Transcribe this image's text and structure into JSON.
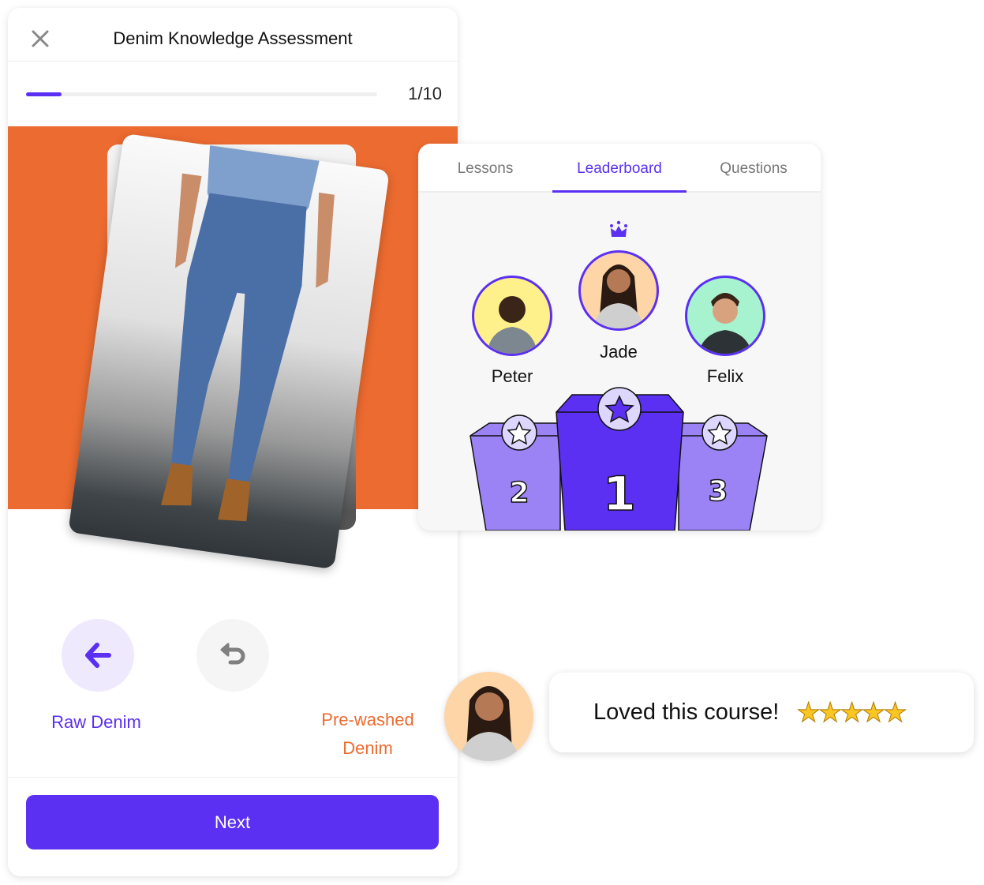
{
  "quiz": {
    "title": "Denim Knowledge Assessment",
    "progress": {
      "current": 1,
      "total": 10,
      "label": "1/10",
      "fraction": 0.1
    },
    "options": {
      "left": "Raw Denim",
      "right": "Pre-washed Denim"
    },
    "next_label": "Next",
    "colors": {
      "accent": "#5B30F2",
      "orange": "#EC6B30"
    }
  },
  "leaderboard": {
    "tabs": [
      {
        "label": "Lessons"
      },
      {
        "label": "Leaderboard",
        "active": true
      },
      {
        "label": "Questions"
      }
    ],
    "players": [
      {
        "name": "Peter",
        "rank": "2",
        "bg": "#FEF08A"
      },
      {
        "name": "Jade",
        "rank": "1",
        "bg": "#FDD5A6"
      },
      {
        "name": "Felix",
        "rank": "3",
        "bg": "#A7F3D0"
      }
    ]
  },
  "review": {
    "text": "Loved this course!",
    "rating": 5,
    "stars": "★★★★★"
  }
}
